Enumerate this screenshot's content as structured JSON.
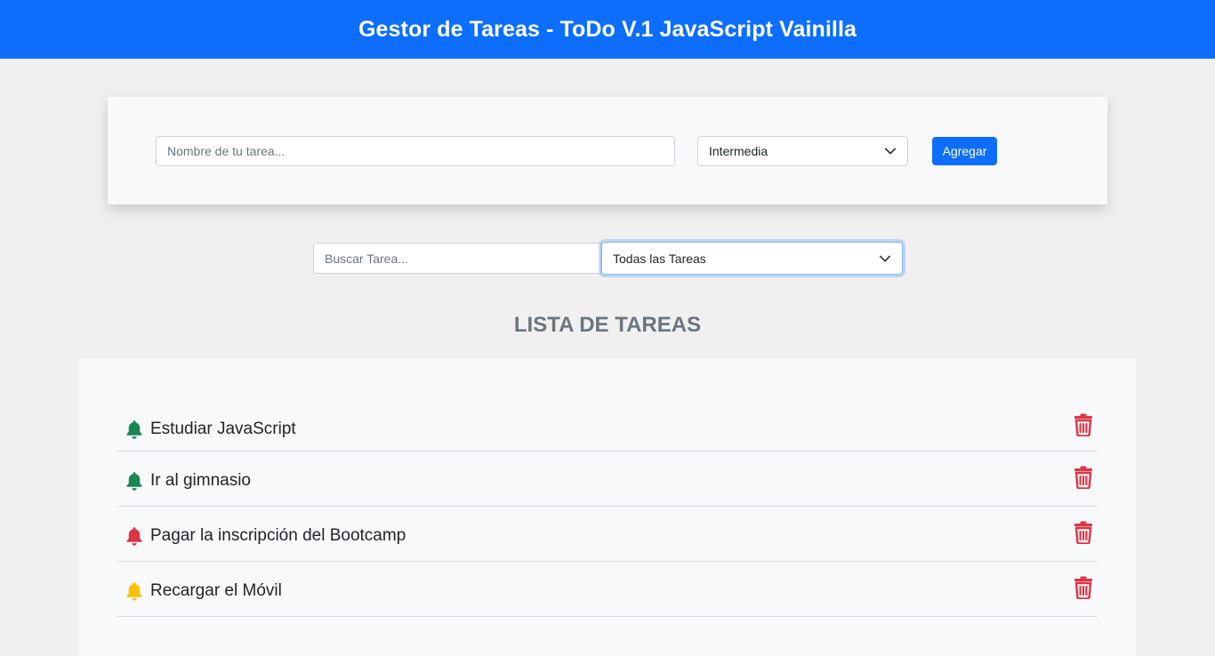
{
  "header": {
    "title": "Gestor de Tareas - ToDo V.1 JavaScript Vainilla"
  },
  "add_form": {
    "task_name_placeholder": "Nombre de tu tarea...",
    "task_name_value": "",
    "priority_selected": "Intermedia",
    "add_button_label": "Agregar"
  },
  "filters": {
    "search_placeholder": "Buscar Tarea...",
    "search_value": "",
    "filter_selected": "Todas las Tareas"
  },
  "list": {
    "heading": "LISTA DE TAREAS",
    "tasks": [
      {
        "name": "Estudiar JavaScript",
        "bell_icon": "bell-icon",
        "bell_color": "#198754",
        "delete_icon": "trash-icon"
      },
      {
        "name": "Ir al gimnasio",
        "bell_icon": "bell-icon",
        "bell_color": "#198754",
        "delete_icon": "trash-icon"
      },
      {
        "name": "Pagar la inscripción del Bootcamp",
        "bell_icon": "bell-icon",
        "bell_color": "#dc3545",
        "delete_icon": "trash-icon"
      },
      {
        "name": "Recargar el Móvil",
        "bell_icon": "bell-icon",
        "bell_color": "#ffc107",
        "delete_icon": "trash-icon"
      }
    ]
  },
  "colors": {
    "primary": "#0d6efd",
    "delete": "#dc3545",
    "page_background": "#f0f0f0",
    "card_background": "#f8f9fa"
  }
}
